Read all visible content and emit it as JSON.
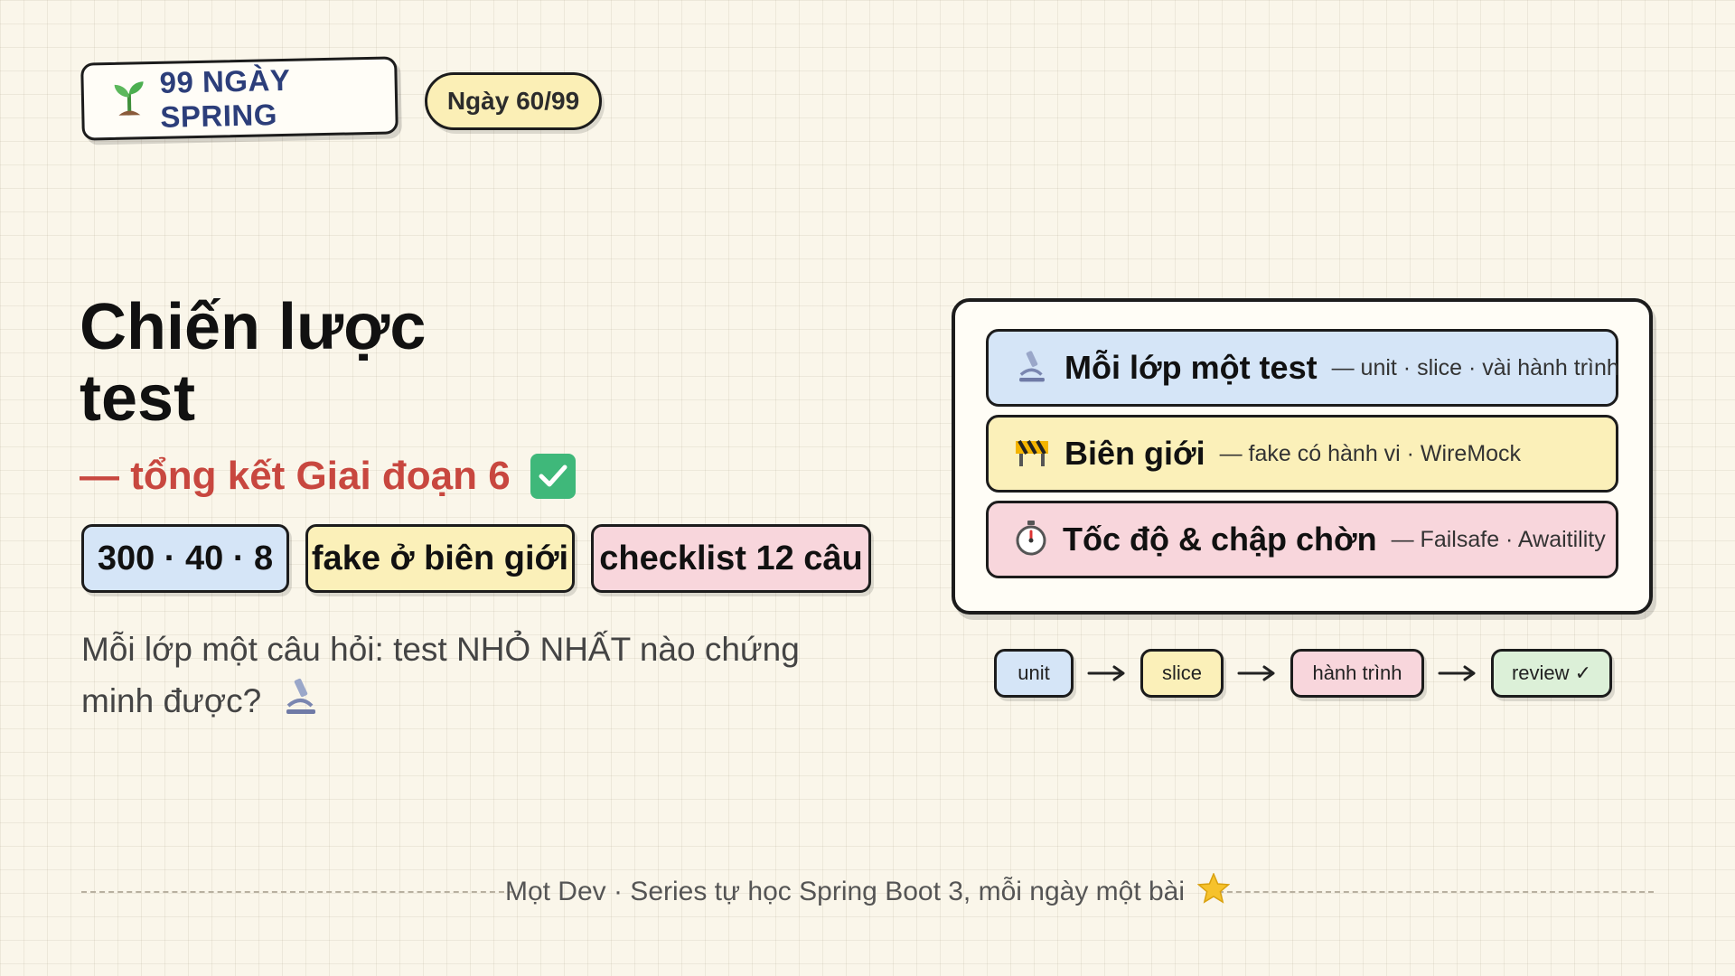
{
  "header": {
    "brand_label": "99 NGÀY SPRING",
    "day_badge": "Ngày 60/99"
  },
  "title": {
    "line1": "Chiến lược",
    "line2": "test",
    "subtitle": "— tổng kết Giai đoạn 6"
  },
  "chips": [
    {
      "label": "300 · 40 · 8"
    },
    {
      "label": "fake ở biên giới"
    },
    {
      "label": "checklist 12 câu"
    }
  ],
  "question": "Mỗi lớp một câu hỏi: test NHỎ NHẤT nào chứng minh được?",
  "card": {
    "rows": [
      {
        "title": "Mỗi lớp một test",
        "desc": "— unit · slice · vài hành trình",
        "icon": "microscope-icon"
      },
      {
        "title": "Biên giới",
        "desc": "— fake có hành vi · WireMock",
        "icon": "barrier-icon"
      },
      {
        "title": "Tốc độ & chập chờn",
        "desc": "— Failsafe · Awaitility",
        "icon": "stopwatch-icon"
      }
    ]
  },
  "flow": {
    "steps": [
      "unit",
      "slice",
      "hành trình",
      "review ✓"
    ]
  },
  "footer": {
    "text": "Mọt Dev · Series tự học Spring Boot 3, mỗi ngày một bài"
  },
  "colors": {
    "background": "#faf6ea",
    "blue": "#d5e5f7",
    "yellow": "#fbf0b9",
    "pink": "#f8d6dc",
    "green": "#dcf0d8",
    "subtitle_red": "#c8473f",
    "brand_navy": "#2c3e7a",
    "check_green": "#3fb87a"
  }
}
